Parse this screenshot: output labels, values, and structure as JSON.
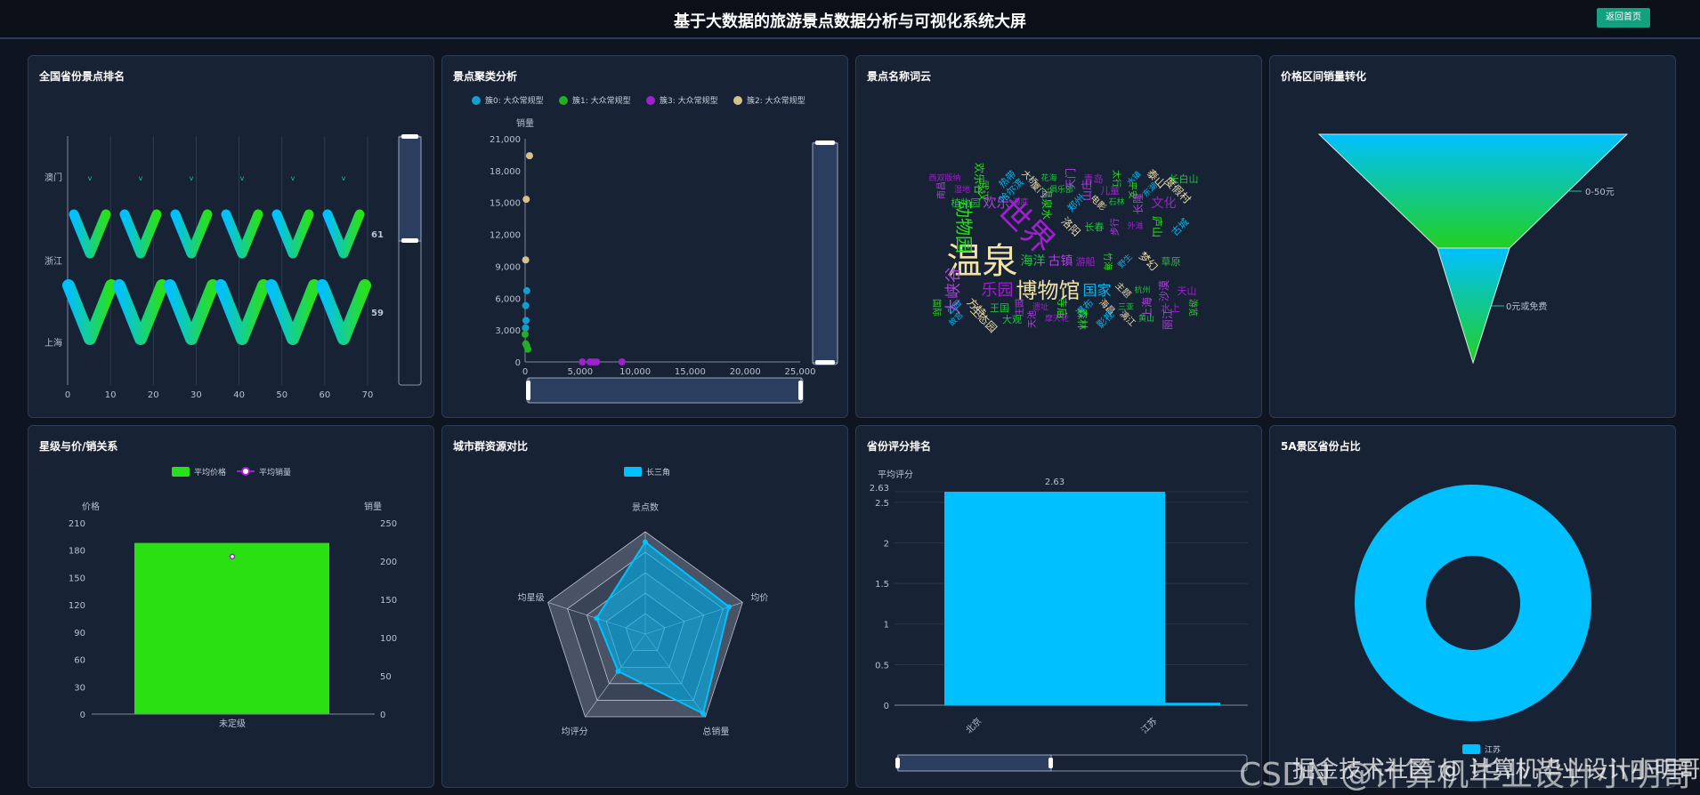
{
  "header": {
    "title": "基于大数据的旅游景点数据分析与可视化系统大屏",
    "home_button": "返回首页"
  },
  "panels": {
    "province_rank": {
      "title": "全国省份景点排名"
    },
    "cluster": {
      "title": "景点聚类分析"
    },
    "wordcloud": {
      "title": "景点名称词云"
    },
    "funnel": {
      "title": "价格区间销量转化"
    },
    "star": {
      "title": "星级与价/销关系"
    },
    "radar": {
      "title": "城市群资源对比"
    },
    "score": {
      "title": "省份评分排名"
    },
    "donut": {
      "title": "5A景区省份占比"
    }
  },
  "colors": {
    "accent": "#00c0ff",
    "green": "#2ae01a",
    "purple": "#a020d0",
    "tan": "#d8c08a",
    "blue": "#109fd0"
  },
  "chart_data": [
    {
      "id": "province_rank",
      "type": "pictorial-bar",
      "categories": [
        "澳门",
        "浙江",
        "上海"
      ],
      "values": [
        null,
        61,
        59
      ],
      "value_labels": [
        "",
        "61",
        "59"
      ],
      "xlim": [
        0,
        70
      ],
      "xticks": [
        0,
        10,
        20,
        30,
        40,
        50,
        60,
        70
      ],
      "symbol": "v"
    },
    {
      "id": "cluster",
      "type": "scatter",
      "ylabel": "销量",
      "xlim": [
        0,
        25000
      ],
      "ylim": [
        0,
        21000
      ],
      "xticks": [
        "0",
        "5,000",
        "10,000",
        "15,000",
        "20,000",
        "25,000"
      ],
      "yticks": [
        "0",
        "3,000",
        "6,000",
        "9,000",
        "12,000",
        "15,000",
        "18,000",
        "21,000"
      ],
      "series": [
        {
          "name": "簇0: 大众常规型",
          "color": "#109fd0",
          "points": [
            [
              150,
              6700
            ],
            [
              50,
              5300
            ],
            [
              80,
              3900
            ],
            [
              30,
              3200
            ]
          ]
        },
        {
          "name": "簇1: 大众常规型",
          "color": "#22b022",
          "points": [
            [
              0,
              2600
            ],
            [
              60,
              1700
            ],
            [
              150,
              1500
            ],
            [
              250,
              1200
            ]
          ]
        },
        {
          "name": "簇3: 大众常规型",
          "color": "#a020d0",
          "points": [
            [
              5200,
              0
            ],
            [
              5900,
              0
            ],
            [
              6200,
              0
            ],
            [
              6500,
              0
            ],
            [
              8800,
              0
            ]
          ]
        },
        {
          "name": "簇2: 大众常规型",
          "color": "#d8c08a",
          "points": [
            [
              400,
              19400
            ],
            [
              100,
              15300
            ],
            [
              50,
              9600
            ]
          ]
        }
      ]
    },
    {
      "id": "wordcloud",
      "type": "wordcloud",
      "words": [
        "西双版纳",
        "欢乐谷",
        "热带",
        "大桥",
        "花海",
        "天门",
        "青岛",
        "太行",
        "水镇",
        "泰山",
        "长白山",
        "南昌",
        "湿地",
        "武汉",
        "哈尔滨",
        "厦门",
        "俱乐部",
        "山庄",
        "儿童",
        "平安",
        "东湖",
        "度假村",
        "植物园",
        "欢乐",
        "海底",
        "温泉水",
        "郑州",
        "电影",
        "石林",
        "长隆",
        "文化",
        "动物园",
        "世界",
        "洛阳",
        "长春",
        "步行",
        "外滩",
        "庐山",
        "古城",
        "温泉",
        "海洋",
        "古镇",
        "游船",
        "竹海",
        "野生",
        "梦幻",
        "草原",
        "大峡谷",
        "乐园",
        "博物馆",
        "国家",
        "主题",
        "杭州",
        "沙漠",
        "天山",
        "国际",
        "公园",
        "方特",
        "王国",
        "庄园",
        "遗址",
        "寺庙",
        "瀑布",
        "海昌",
        "三亚",
        "上海",
        "水上",
        "游览",
        "故宫",
        "生态园",
        "大观",
        "天池",
        "摩天轮",
        "森林",
        "影视",
        "漓江",
        "黄山",
        "丽江"
      ]
    },
    {
      "id": "funnel",
      "type": "funnel",
      "categories": [
        "0-50元",
        "0元或免费"
      ],
      "values": [
        100,
        50
      ]
    },
    {
      "id": "star",
      "type": "bar-line",
      "legend": [
        "平均价格",
        "平均销量"
      ],
      "categories": [
        "未定级"
      ],
      "left_axis": {
        "name": "价格",
        "ylim": [
          0,
          210
        ],
        "ticks": [
          "0",
          "30",
          "60",
          "90",
          "120",
          "150",
          "180",
          "210"
        ]
      },
      "right_axis": {
        "name": "销量",
        "ylim": [
          0,
          250
        ],
        "ticks": [
          "0",
          "50",
          "100",
          "150",
          "200",
          "250"
        ]
      },
      "series": [
        {
          "name": "平均价格",
          "type": "bar",
          "values": [
            188
          ]
        },
        {
          "name": "平均销量",
          "type": "line",
          "values": [
            206
          ]
        }
      ]
    },
    {
      "id": "radar",
      "type": "radar",
      "legend": [
        "长三角"
      ],
      "indicators": [
        "景点数",
        "均价",
        "总销量",
        "均评分",
        "均星级"
      ],
      "values": [
        0.9,
        0.86,
        0.96,
        0.45,
        0.5
      ]
    },
    {
      "id": "score",
      "type": "bar",
      "ylabel": "平均评分",
      "categories": [
        "北京",
        "江苏"
      ],
      "values": [
        2.63,
        0.03
      ],
      "data_label": "2.63",
      "yticks": [
        "0",
        "0.5",
        "1",
        "1.5",
        "2",
        "2.5",
        "2.63"
      ],
      "ylim": [
        0,
        2.63
      ]
    },
    {
      "id": "donut",
      "type": "pie",
      "legend": [
        "江苏"
      ],
      "values": [
        1
      ]
    }
  ],
  "watermarks": [
    "CSDN @计算机毕业设计小明哥",
    "掘金技术社区 @ 计算机毕业设计小明哥"
  ]
}
